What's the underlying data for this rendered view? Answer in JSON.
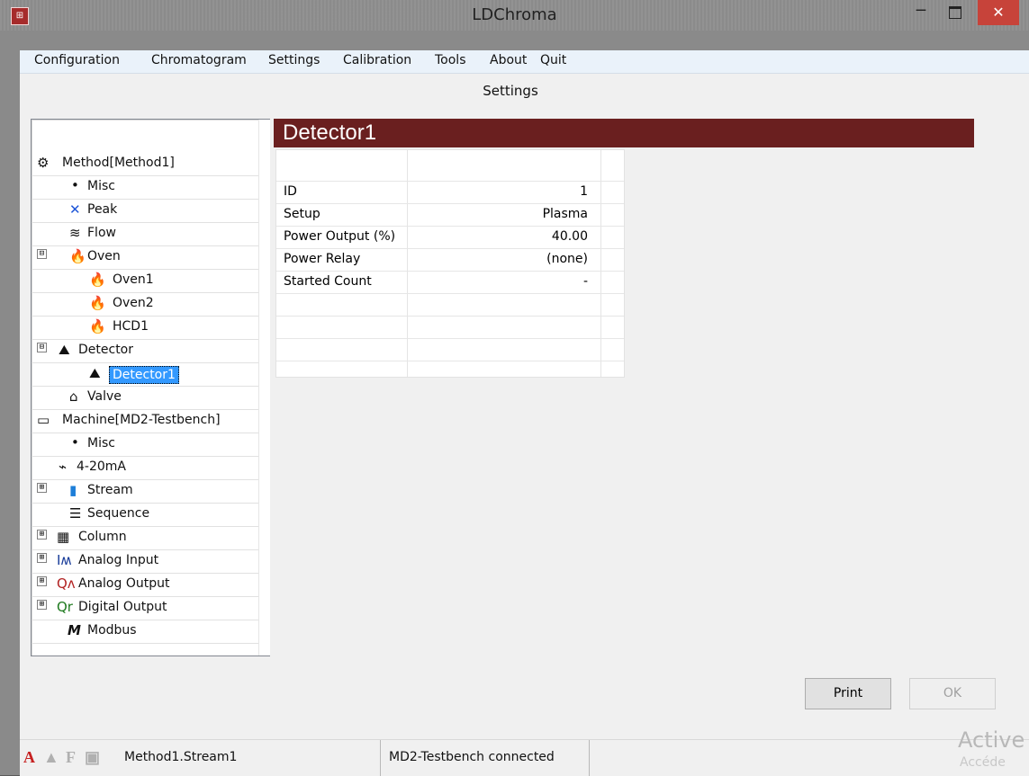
{
  "window": {
    "title": "LDChroma",
    "app_icon": "window-app-icon",
    "close_glyph": "✕"
  },
  "menu": [
    "Configuration",
    "Chromatogram",
    "Settings",
    "Calibration",
    "Tools",
    "About",
    "Quit"
  ],
  "page": {
    "heading": "Settings"
  },
  "tree": {
    "items": [
      {
        "label": "Method[Method1]",
        "icon": "gears-icon"
      },
      {
        "label": "Misc",
        "icon": "bullet-icon"
      },
      {
        "label": "Peak",
        "icon": "peak-icon"
      },
      {
        "label": "Flow",
        "icon": "flow-icon"
      },
      {
        "label": "Oven",
        "icon": "flame-icon",
        "expander": "⊟"
      },
      {
        "label": "Oven1",
        "icon": "flame-icon"
      },
      {
        "label": "Oven2",
        "icon": "flame-icon"
      },
      {
        "label": "HCD1",
        "icon": "flame-icon"
      },
      {
        "label": "Detector",
        "icon": "detector-icon",
        "expander": "⊟"
      },
      {
        "label": "Detector1",
        "icon": "detector-icon"
      },
      {
        "label": "Valve",
        "icon": "valve-icon"
      },
      {
        "label": "Machine[MD2-Testbench]",
        "icon": "machine-icon"
      },
      {
        "label": "Misc",
        "icon": "bullet-icon"
      },
      {
        "label": "4-20mA",
        "icon": "resistor-icon"
      },
      {
        "label": "Stream",
        "icon": "bottle-icon",
        "expander": "⊞"
      },
      {
        "label": "Sequence",
        "icon": "list-icon"
      },
      {
        "label": "Column",
        "icon": "column-icon",
        "expander": "⊞"
      },
      {
        "label": "Analog Input",
        "icon": "analog-input-icon",
        "expander": "⊞"
      },
      {
        "label": "Analog Output",
        "icon": "analog-output-icon",
        "expander": "⊞"
      },
      {
        "label": "Digital Output",
        "icon": "digital-output-icon",
        "expander": "⊞"
      },
      {
        "label": "Modbus",
        "icon": "modbus-icon"
      }
    ]
  },
  "detector": {
    "title": "Detector1",
    "rows": [
      {
        "label": "ID",
        "value": "1"
      },
      {
        "label": "Setup",
        "value": "Plasma"
      },
      {
        "label": "Power Output (%)",
        "value": "40.00"
      },
      {
        "label": "Power Relay",
        "value": "(none)"
      },
      {
        "label": "Started Count",
        "value": "-"
      }
    ]
  },
  "buttons": {
    "print": "Print",
    "ok": "OK"
  },
  "status": {
    "stream": "Method1.Stream1",
    "connection": "MD2-Testbench connected"
  },
  "watermark": {
    "text": "Active",
    "sub": "Accéde"
  },
  "colors": {
    "title_bar": "#8f8f8f",
    "menu_bg": "#eaf2fa",
    "header_bg": "#6a1f1f",
    "selection": "#3399ff",
    "close_red": "#c7433a"
  }
}
